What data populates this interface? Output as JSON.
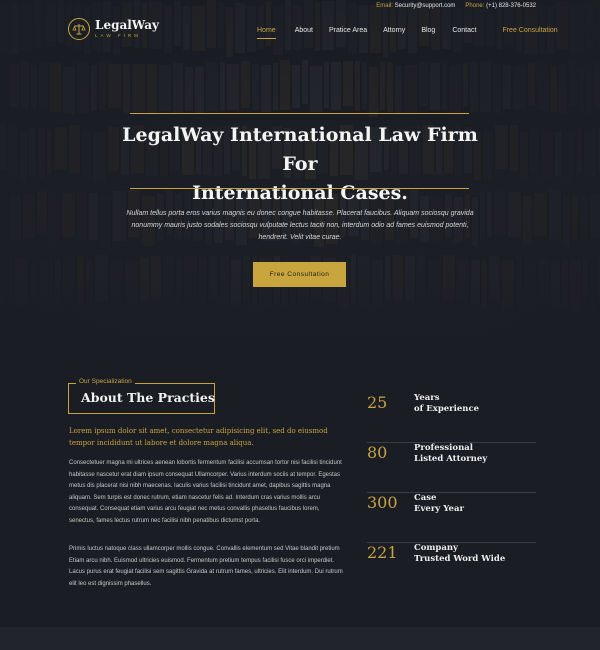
{
  "topbar": {
    "email_label": "Email:",
    "email_value": "Security@support.com",
    "phone_label": "Phone:",
    "phone_value": "(+1) 828-376-0532"
  },
  "logo": {
    "name": "LegalWay",
    "tagline": "LAW FIRM"
  },
  "nav": {
    "items": [
      "Home",
      "About",
      "Pratice Area",
      "Attorny",
      "Blog",
      "Contact"
    ],
    "cta": "Free Consultation",
    "active": "Home"
  },
  "hero": {
    "title_line1": "LegalWay International Law Firm For",
    "title_line2": "International Cases.",
    "subtitle": "Nullam tellus porta eros varius magnis eu donec congue habitasse. Placerat faucibus. Aliquam sociosqu gravida nonummy mauris justo sodales sociosqu vulputate lectus taciti non, interdum odio ad fames euismod potenti, hendrerit. Velit vitae curae.",
    "button": "Free Consultation"
  },
  "about": {
    "kicker": "Our Specialization",
    "title": "About The Practies",
    "lead": "Lorem ipsum dolor sit amet, consectetur adipisicing elit, sed do eiusmod tempor incididunt ut labore et dolore magna aliqua.",
    "paragraph1": "Consectetuer magna mi ultrices aenean lobortis fermentum facilisi accumsan tortor nisi facilisi tincidunt habitasse nascetur erat diam ipsum consequat Ullamcorper. Varius interdum sociis at tempor. Egestas metus dis placerat nisi nibh maecenas. Iaculis varius facilisi tincidunt amet, dapibus sagittis magna aliquam. Sem turpis est donec rutrum, etiam nascetur felis ad. Interdum cras varius mollis arcu consequat. Consequat etiam varius arcu feugiat nec metus convallis phasellus faucibus lorem, senectus, fames lectus rutrum nec facilisi nibh penatibus dictumst porta.",
    "paragraph2": "Primis luctus natoque class ullamcorper mollis congue. Convallis elementum sed Vitae blandit pretium Etiam arcu nibh. Euismod ultricies euismod. Fermentum pretium tempus facilisi fusce orci imperdiet. Lacus purus erat feugiat facilisi sem sagittis Gravida at rutrum fames, ultricies. Elit interdum. Dui rutrum elit leo est dignissim phasellus."
  },
  "stats": [
    {
      "value": "25",
      "line1": "Years",
      "line2": "of Experience"
    },
    {
      "value": "80",
      "line1": "Professional",
      "line2": "Listed Attorney"
    },
    {
      "value": "300",
      "line1": "Case",
      "line2": "Every Year"
    },
    {
      "value": "221",
      "line1": "Company",
      "line2": "Trusted Word Wide"
    }
  ],
  "colors": {
    "accent": "#c8a441",
    "background": "#1b1d24",
    "text": "#c9c9c9"
  }
}
